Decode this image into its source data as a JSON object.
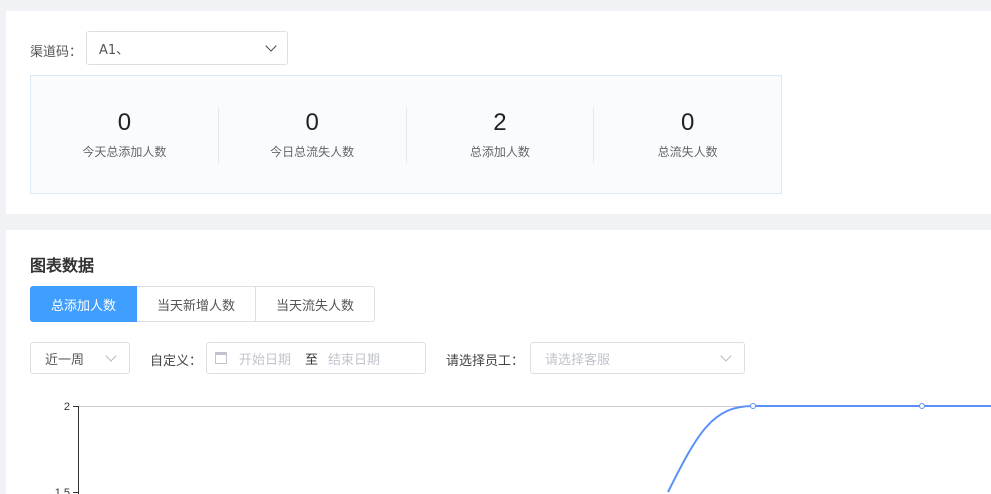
{
  "channel": {
    "label": "渠道码：",
    "value": "A1、"
  },
  "stats": [
    {
      "value": "0",
      "label": "今天总添加人数"
    },
    {
      "value": "0",
      "label": "今日总流失人数"
    },
    {
      "value": "2",
      "label": "总添加人数"
    },
    {
      "value": "0",
      "label": "总流失人数"
    }
  ],
  "chart_section": {
    "title": "图表数据",
    "tabs": [
      {
        "label": "总添加人数",
        "active": true
      },
      {
        "label": "当天新增人数",
        "active": false
      },
      {
        "label": "当天流失人数",
        "active": false
      }
    ]
  },
  "filters": {
    "period": "近一周",
    "custom_label": "自定义：",
    "start_placeholder": "开始日期",
    "range_separator": "至",
    "end_placeholder": "结束日期",
    "staff_label": "请选择员工：",
    "staff_placeholder": "请选择客服"
  },
  "colors": {
    "primary": "#409eff",
    "line": "#5b8ff9"
  },
  "chart_data": {
    "type": "line",
    "y_ticks": [
      "2",
      "1.5"
    ],
    "ylim": [
      1.5,
      2
    ],
    "series": [
      {
        "points": [
          {
            "y": 1.5,
            "marker": false
          },
          {
            "y": 2,
            "marker": true
          },
          {
            "y": 2,
            "marker": true
          },
          {
            "y": 2,
            "marker": false
          }
        ]
      }
    ]
  }
}
